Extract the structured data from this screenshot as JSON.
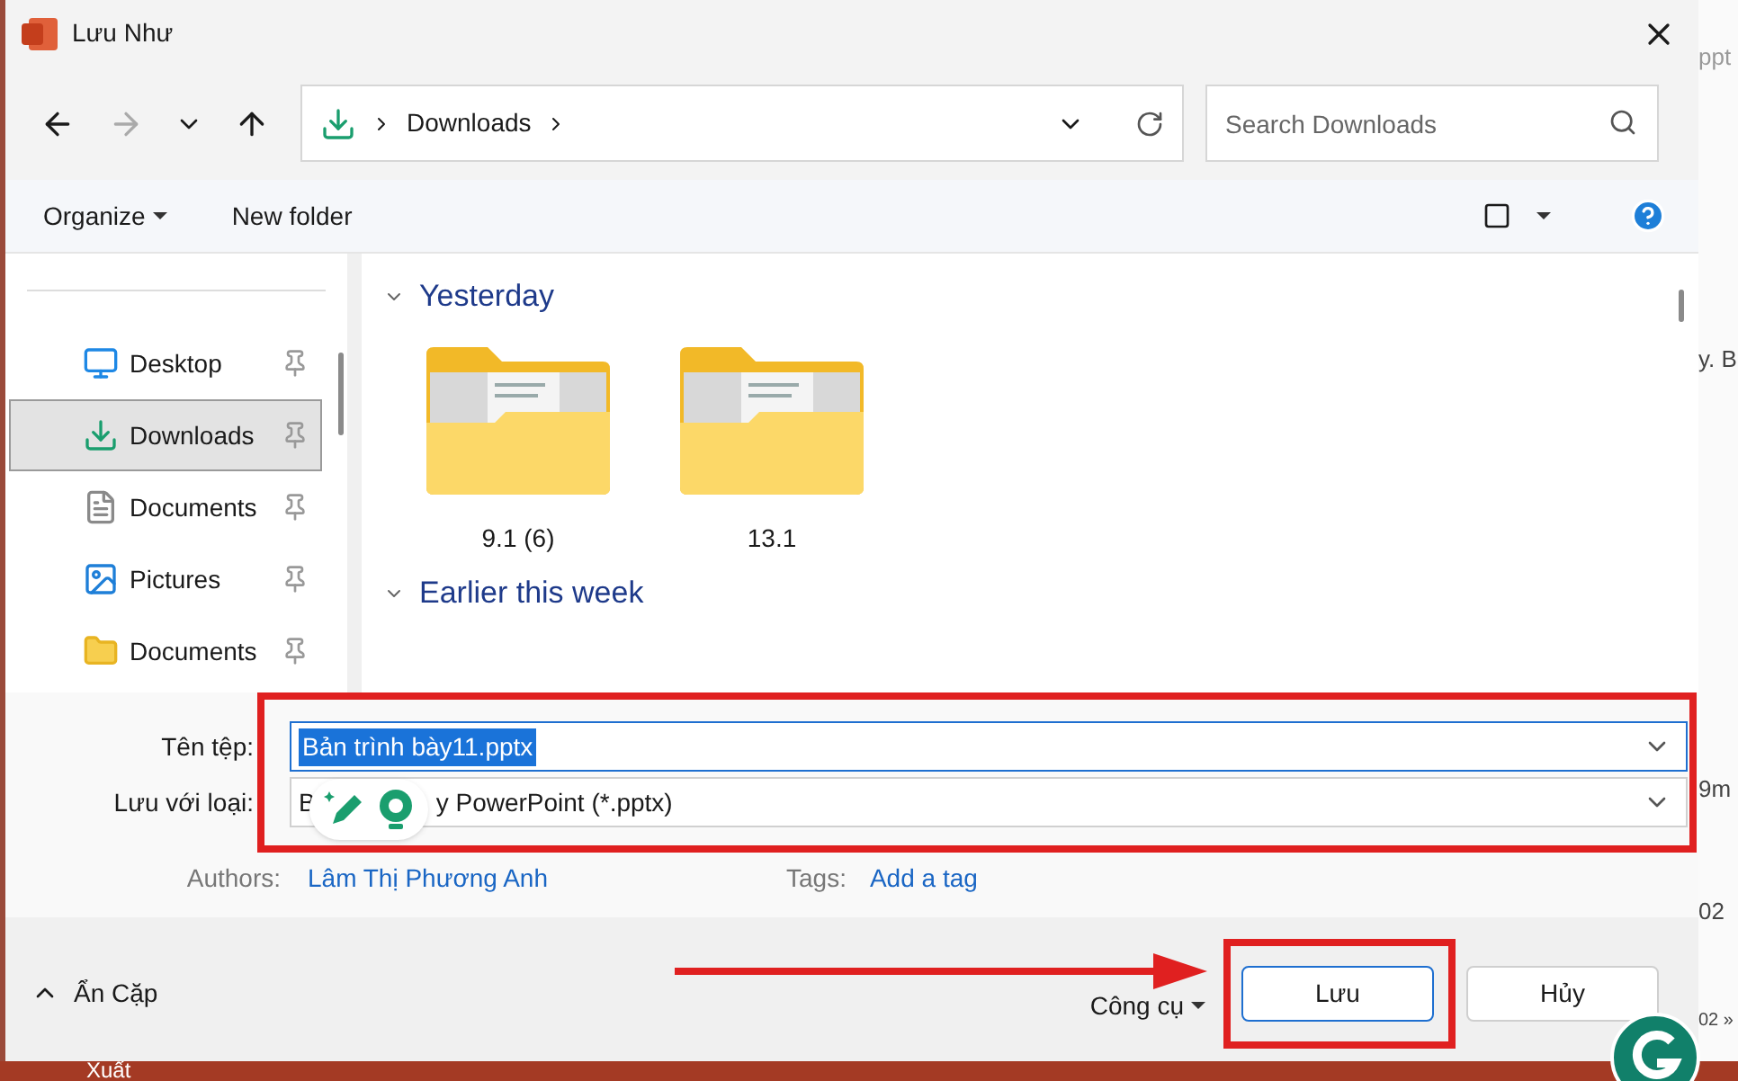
{
  "window": {
    "title": "Lưu Như"
  },
  "nav": {
    "path": [
      "Downloads"
    ],
    "search_placeholder": "Search Downloads"
  },
  "toolbar": {
    "organize": "Organize",
    "new_folder": "New folder"
  },
  "sidebar": {
    "items": [
      {
        "label": "Desktop",
        "kind": "desktop",
        "selected": false
      },
      {
        "label": "Downloads",
        "kind": "downloads",
        "selected": true
      },
      {
        "label": "Documents",
        "kind": "documents",
        "selected": false
      },
      {
        "label": "Pictures",
        "kind": "pictures",
        "selected": false
      },
      {
        "label": "Documents",
        "kind": "folder",
        "selected": false
      }
    ]
  },
  "groups": [
    {
      "title": "Yesterday",
      "expanded": true,
      "items": [
        {
          "name": "9.1 (6)"
        },
        {
          "name": "13.1"
        }
      ]
    },
    {
      "title": "Earlier this week",
      "expanded": true
    }
  ],
  "form": {
    "filename_label": "Tên tệp:",
    "filename": "Bản trình bày11.pptx",
    "type_label": "Lưu với loại:",
    "type_value_start": "B",
    "type_value_end": "y PowerPoint (*.pptx)",
    "authors_label": "Authors:",
    "author": "Lâm Thị Phương Anh",
    "tags_label": "Tags:",
    "tag_link": "Add a tag"
  },
  "footer": {
    "hide_folders": "Ẩn Cặp",
    "tools": "Công cụ",
    "save": "Lưu",
    "cancel": "Hủy"
  },
  "background": {
    "top": "ppt",
    "rows": [
      "y. B",
      "9m",
      "02",
      "02 »"
    ],
    "bottom": "Xuất"
  }
}
